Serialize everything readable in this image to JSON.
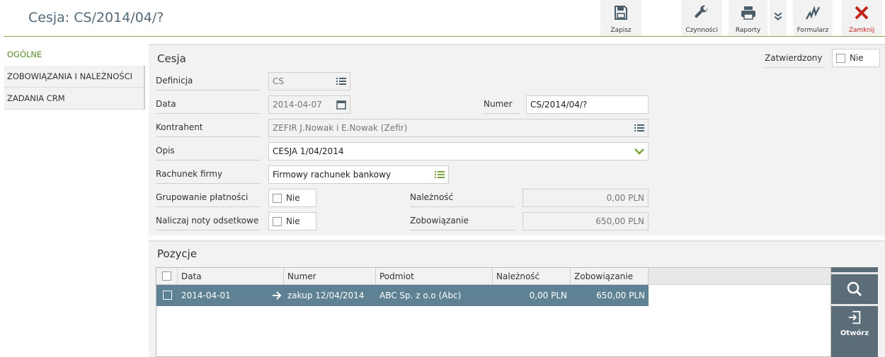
{
  "window": {
    "title": "Cesja: CS/2014/04/?"
  },
  "toolbar": {
    "save": {
      "label": "Zapisz",
      "icon": "save-icon"
    },
    "actions": {
      "label": "Czynności",
      "icon": "wrench-icon"
    },
    "reports": {
      "label": "Raporty",
      "icon": "printer-icon"
    },
    "more": {
      "icon": "double-chevron-down-icon"
    },
    "form": {
      "label": "Formularz",
      "icon": "signature-icon"
    },
    "close": {
      "label": "Zamknij",
      "icon": "close-icon"
    }
  },
  "tabs": [
    {
      "label": "OGÓLNE",
      "active": true
    },
    {
      "label": "ZOBOWIĄZANIA I NALEŻNOŚCI",
      "active": false
    },
    {
      "label": "ZADANIA CRM",
      "active": false
    }
  ],
  "form": {
    "section_title": "Cesja",
    "approved": {
      "label": "Zatwierdzony",
      "value": "Nie"
    },
    "definition": {
      "label": "Definicja",
      "value": "CS"
    },
    "date": {
      "label": "Data",
      "value": "2014-04-07"
    },
    "number": {
      "label": "Numer",
      "value": "CS/2014/04/?"
    },
    "contractor": {
      "label": "Kontrahent",
      "value": "ZEFIR J.Nowak i E.Nowak (Zefir)"
    },
    "description": {
      "label": "Opis",
      "value": "CESJA 1/04/2014"
    },
    "account": {
      "label": "Rachunek firmy",
      "value": "Firmowy rachunek bankowy"
    },
    "grouping": {
      "label": "Grupowanie płatności",
      "value": "Nie"
    },
    "interest": {
      "label": "Naliczaj noty odsetkowe",
      "value": "Nie"
    },
    "receivable": {
      "label": "Należność",
      "value": "0,00 PLN"
    },
    "liability": {
      "label": "Zobowiązanie",
      "value": "650,00 PLN"
    }
  },
  "positions": {
    "section_title": "Pozycje",
    "columns": [
      "Data",
      "Numer",
      "Podmiot",
      "Należność",
      "Zobowiązanie"
    ],
    "rows": [
      {
        "date": "2014-04-01",
        "number": "zakup 12/04/2014",
        "entity": "ABC Sp. z o.o (Abc)",
        "receivable": "0,00 PLN",
        "liability": "650,00 PLN"
      }
    ]
  },
  "side_actions": {
    "search": {
      "icon": "search-icon"
    },
    "open": {
      "label": "Otwórz",
      "icon": "open-icon"
    }
  },
  "colors": {
    "accent": "#7aa23a",
    "header_line": "#8da659",
    "row_selected": "#5e8294",
    "close_red": "#c0241b",
    "side_panel": "#5a6d78"
  }
}
